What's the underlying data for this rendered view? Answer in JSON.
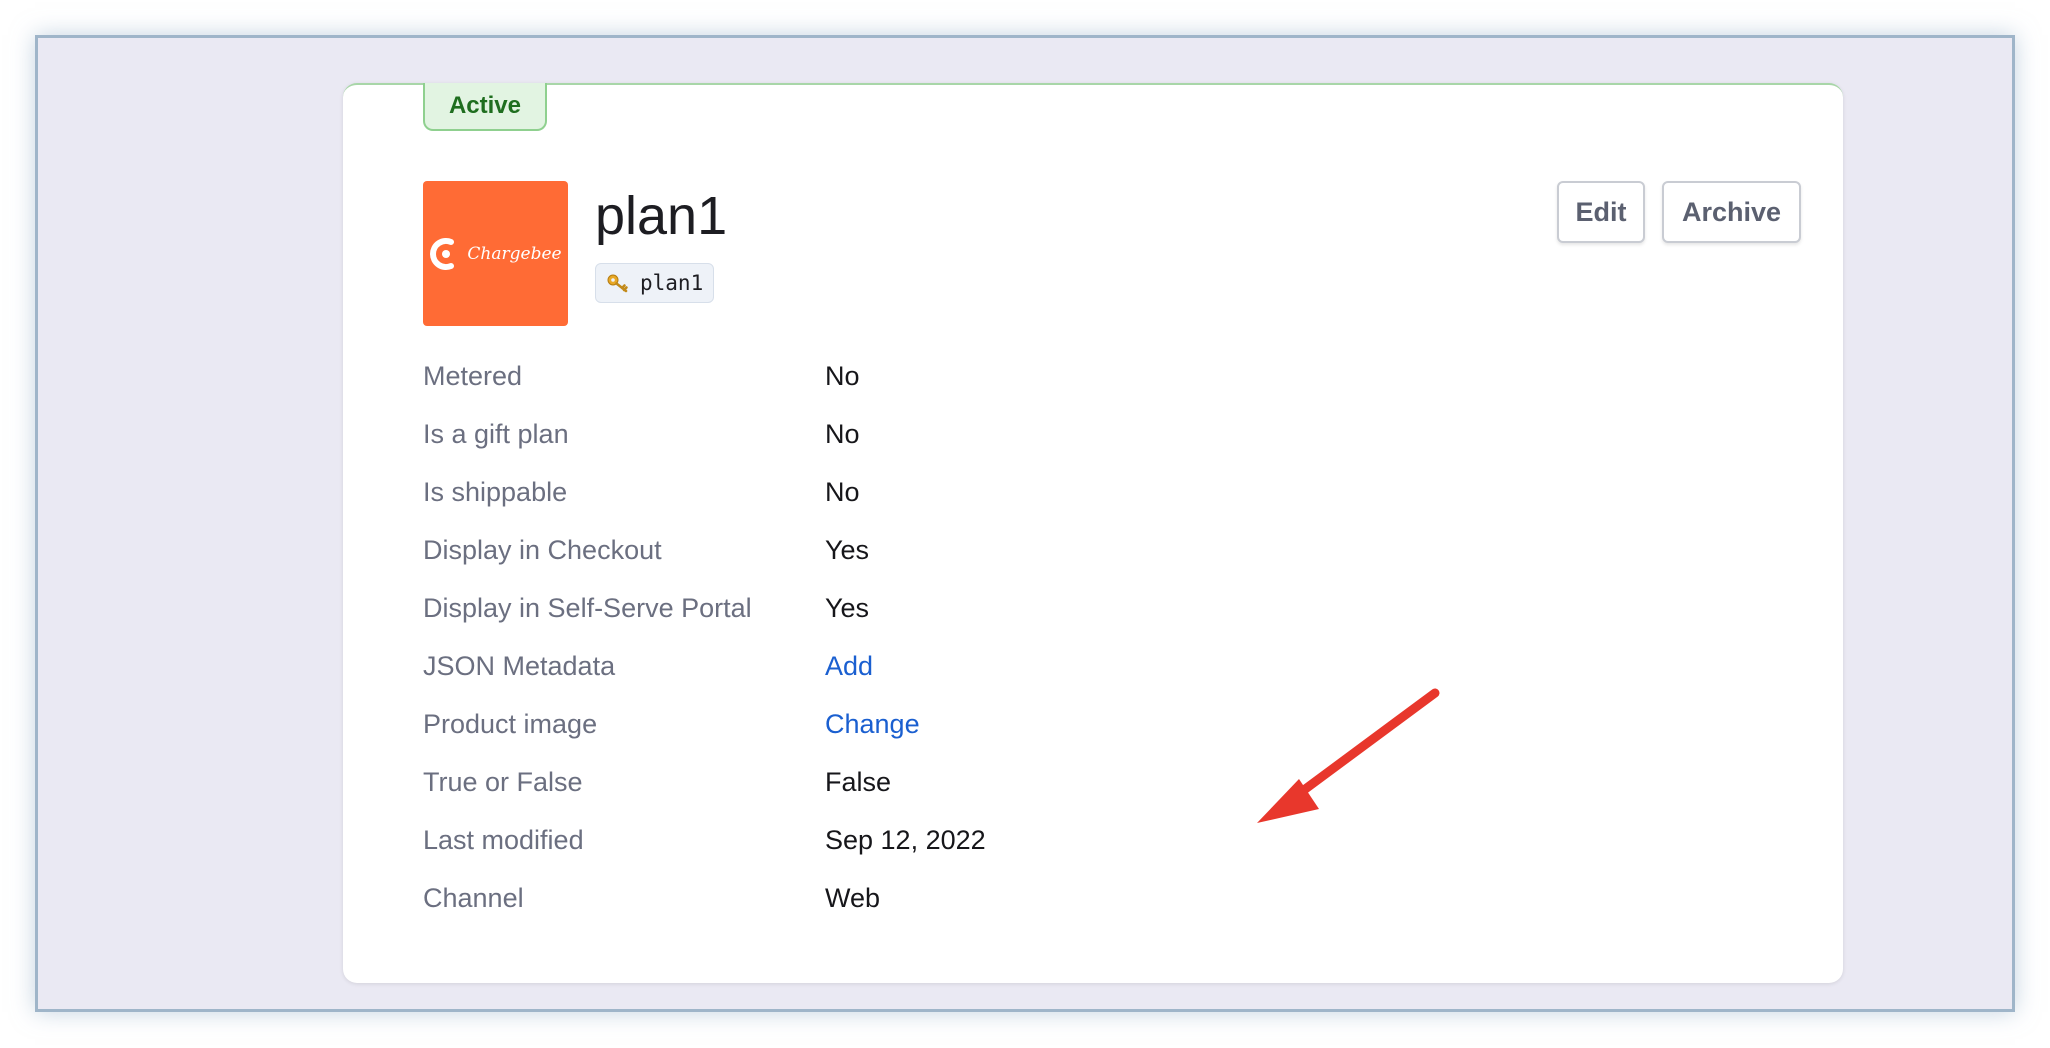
{
  "status": "Active",
  "brand_logo_text": "Chargebee",
  "plan": {
    "name": "plan1",
    "id_icon": "key-icon",
    "id": "plan1"
  },
  "actions": {
    "edit_label": "Edit",
    "archive_label": "Archive"
  },
  "details": [
    {
      "label": "Metered",
      "value": "No",
      "link": false
    },
    {
      "label": "Is a gift plan",
      "value": "No",
      "link": false
    },
    {
      "label": "Is shippable",
      "value": "No",
      "link": false
    },
    {
      "label": "Display in Checkout",
      "value": "Yes",
      "link": false
    },
    {
      "label": "Display in Self-Serve Portal",
      "value": "Yes",
      "link": false
    },
    {
      "label": "JSON Metadata",
      "value": "Add",
      "link": true
    },
    {
      "label": "Product image",
      "value": "Change",
      "link": true
    },
    {
      "label": "True or False",
      "value": "False",
      "link": false
    },
    {
      "label": "Last modified",
      "value": "Sep 12, 2022",
      "link": false
    },
    {
      "label": "Channel",
      "value": "Web",
      "link": false
    }
  ],
  "colors": {
    "status_bg": "#e2f4e2",
    "status_text": "#1f6e1f",
    "brand_orange": "#ff6b35",
    "link_blue": "#1a5fd0",
    "annotation_arrow": "#e8372c"
  }
}
